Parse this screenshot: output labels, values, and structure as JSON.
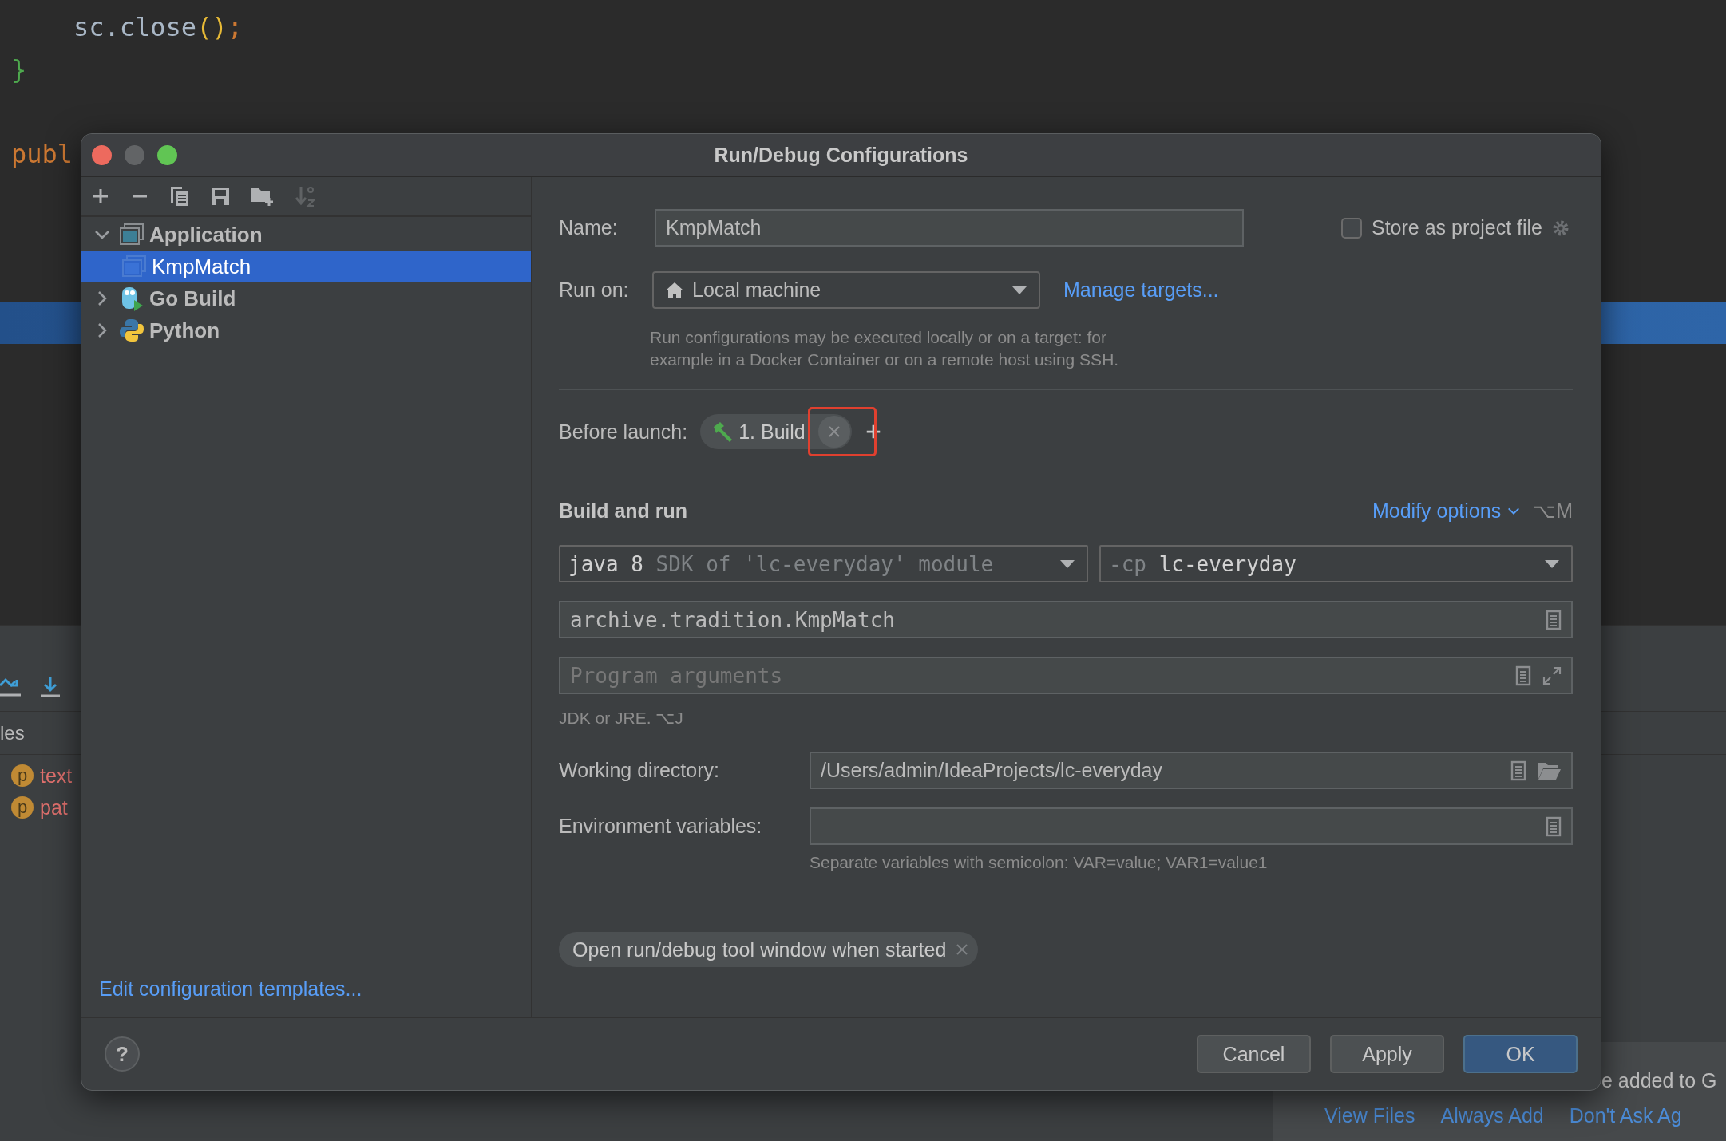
{
  "editor": {
    "lines": [
      {
        "kind": "code",
        "indented": true,
        "tokens": [
          {
            "kind": "ident",
            "text": "sc.close"
          },
          {
            "kind": "paren",
            "text": "()"
          },
          {
            "kind": "punct",
            "text": ";"
          }
        ]
      },
      {
        "kind": "code",
        "indented": false,
        "tokens": [
          {
            "kind": "brace",
            "text": "}"
          }
        ]
      },
      {
        "kind": "blank"
      },
      {
        "kind": "code",
        "indented": false,
        "tokens": [
          {
            "kind": "keyword",
            "text": "publ"
          }
        ]
      },
      {
        "kind": "blank"
      },
      {
        "kind": "blank"
      },
      {
        "kind": "blank"
      }
    ],
    "current_line_highlight": true
  },
  "bottom_panel": {
    "header": "les",
    "items": [
      {
        "badge": "p",
        "name": "text"
      },
      {
        "badge": "p",
        "name": "pat"
      }
    ]
  },
  "notification": {
    "message": "e added to G",
    "links": [
      "View Files",
      "Always Add",
      "Don't Ask Ag"
    ]
  },
  "dialog": {
    "title": "Run/Debug Configurations",
    "window_buttons": [
      {
        "kind": "close",
        "disabled": false
      },
      {
        "kind": "minimize",
        "disabled": true
      },
      {
        "kind": "zoom",
        "disabled": false
      }
    ],
    "toolbar": [
      {
        "kind": "add",
        "disabled": false
      },
      {
        "kind": "remove",
        "disabled": false
      },
      {
        "kind": "copy",
        "disabled": false
      },
      {
        "kind": "save",
        "disabled": false
      },
      {
        "kind": "folder",
        "disabled": false
      },
      {
        "kind": "sort",
        "disabled": true
      }
    ],
    "tree": [
      {
        "label": "Application",
        "kind": "application",
        "expanded": true,
        "selected": false,
        "children": [
          {
            "label": "KmpMatch",
            "kind": "config",
            "selected": true
          }
        ]
      },
      {
        "label": "Go Build",
        "kind": "go",
        "expanded": false,
        "selected": false
      },
      {
        "label": "Python",
        "kind": "python",
        "expanded": false,
        "selected": false
      }
    ],
    "templates_link": "Edit configuration templates...",
    "name": {
      "label": "Name:",
      "value": "KmpMatch"
    },
    "store_as_project_file": {
      "label": "Store as project file",
      "checked": false
    },
    "run_on": {
      "label": "Run on:",
      "value": "Local machine",
      "link": "Manage targets..."
    },
    "run_on_hint": "Run configurations may be executed locally or on a target: for example in a Docker Container or on a remote host using SSH.",
    "before_launch": {
      "label": "Before launch:",
      "tasks": [
        {
          "label": "1. Build",
          "marked": true
        }
      ]
    },
    "build_and_run": {
      "title": "Build and run",
      "modify_options": "Modify options",
      "modify_shortcut": "⌥M",
      "sdk": {
        "value": "java 8",
        "hint": "SDK of 'lc-everyday' module"
      },
      "classpath": {
        "prefix": "-cp",
        "value": "lc-everyday"
      },
      "main_class": "archive.tradition.KmpMatch",
      "program_arguments": {
        "placeholder": "Program arguments"
      },
      "jdk_hint": "JDK or JRE. ⌥J",
      "working_directory": {
        "label": "Working directory:",
        "value": "/Users/admin/IdeaProjects/lc-everyday"
      },
      "environment_variables": {
        "label": "Environment variables:"
      },
      "env_hint": "Separate variables with semicolon: VAR=value; VAR1=value1"
    },
    "option_chips": [
      "Open run/debug tool window when started"
    ],
    "help_button": "?",
    "buttons": [
      {
        "label": "Cancel",
        "kind": "default"
      },
      {
        "label": "Apply",
        "kind": "default"
      },
      {
        "label": "OK",
        "kind": "primary"
      }
    ]
  }
}
